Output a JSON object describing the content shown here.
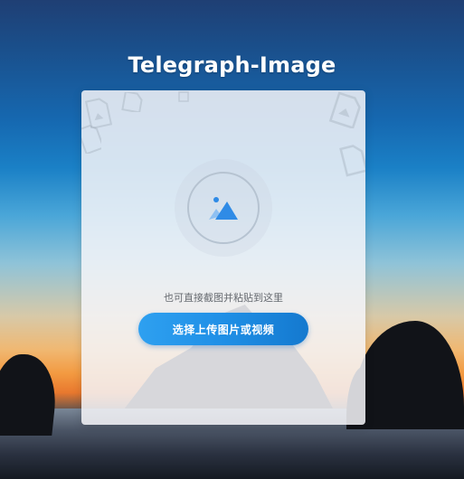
{
  "page": {
    "title": "Telegraph-Image"
  },
  "upload": {
    "hint": "也可直接截图并粘贴到这里",
    "button_label": "选择上传图片或视频",
    "icon": "image-upload-icon"
  },
  "colors": {
    "accent": "#1f8fe6",
    "circle_border": "#b6c3d1",
    "icon_blue": "#2f8be6"
  }
}
